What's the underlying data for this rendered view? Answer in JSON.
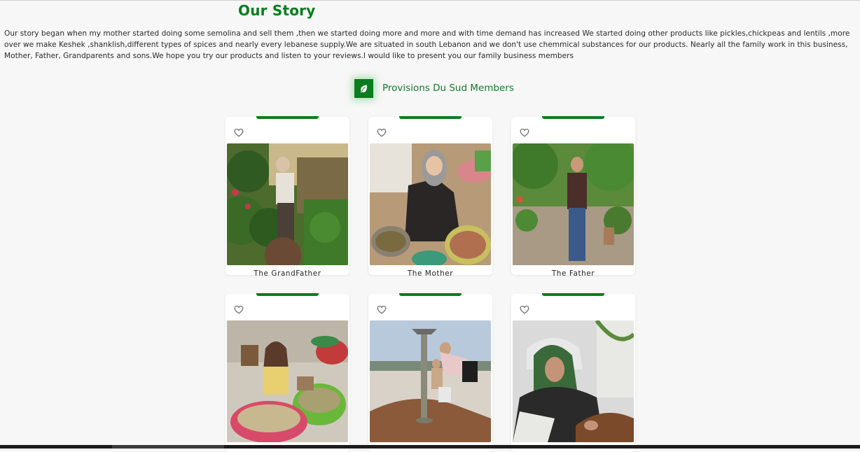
{
  "story": {
    "title": "Our Story",
    "text": "Our story began when my mother started doing some semolina and sell them ,then we started doing more and more and with time demand has increased We started doing other products like pickles,chickpeas and lentils ,more over we make Keshek ,shanklish,different types of spices and nearly every lebanese supply.We are situated in south Lebanon and we don't use chemmical substances for our products. Nearly all the family work in this business, Mother, Father, Grandparents and sons.We hope you try our products and listen to your reviews.I would like to present you our family business members"
  },
  "members": {
    "title": "Provisions Du Sud Members",
    "icon": "leaf-icon",
    "accent": "#0a7d1f",
    "cards": [
      {
        "name": "The GrandFather",
        "icon": "heart-icon"
      },
      {
        "name": "The Mother",
        "icon": "heart-icon"
      },
      {
        "name": "The Father",
        "icon": "heart-icon"
      },
      {
        "name": "",
        "icon": "heart-icon"
      },
      {
        "name": "",
        "icon": "heart-icon"
      },
      {
        "name": "",
        "icon": "heart-icon"
      }
    ]
  }
}
